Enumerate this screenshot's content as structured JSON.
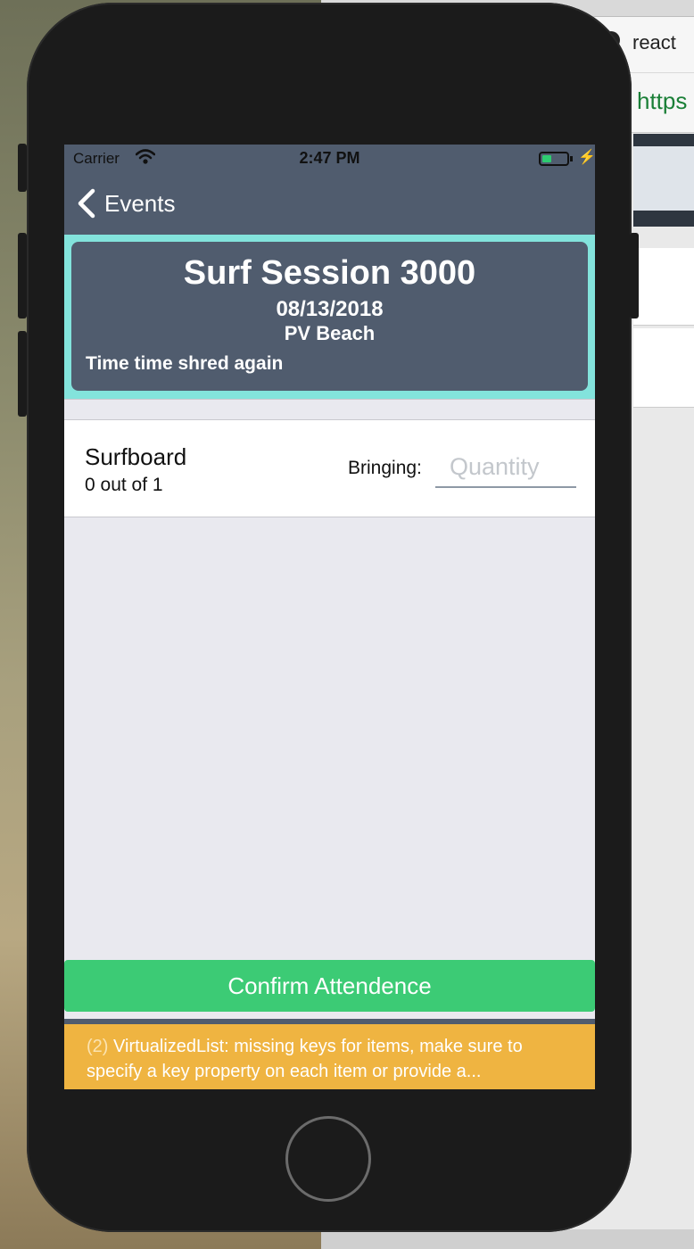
{
  "browser": {
    "tab_title": "react",
    "url_fragment": "https"
  },
  "status_bar": {
    "carrier": "Carrier",
    "time": "2:47 PM",
    "battery_color": "#2ecc71"
  },
  "nav": {
    "back_label": "Events",
    "back_icon": "chevron-left-icon",
    "bar_color": "#505c6e"
  },
  "event": {
    "title": "Surf Session 3000",
    "date": "08/13/2018",
    "location": "PV Beach",
    "description": "Time time shred again",
    "highlight_color": "#83e3dc"
  },
  "items": [
    {
      "name": "Surfboard",
      "count_text": "0 out of 1",
      "bringing_label": "Bringing:",
      "quantity_placeholder": "Quantity",
      "quantity_value": ""
    }
  ],
  "confirm_button": {
    "label": "Confirm Attendence",
    "color": "#3ccb75"
  },
  "warning": {
    "count": "(2)",
    "message": "VirtualizedList: missing keys for items, make sure to specify a key property on each item or provide a...",
    "color": "#efb441"
  }
}
